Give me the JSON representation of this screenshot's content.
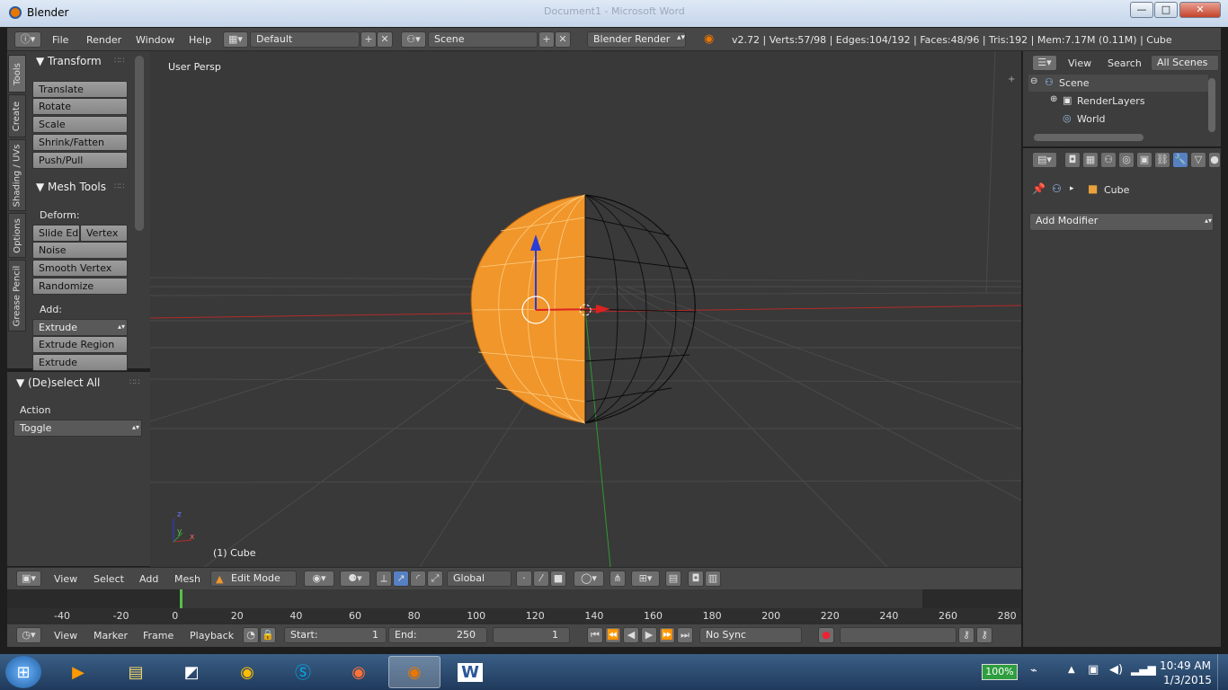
{
  "window": {
    "title": "Blender",
    "ghost_title": "Document1 - Microsoft Word",
    "min": "—",
    "max": "□",
    "close": "✕"
  },
  "info_bar": {
    "menus": [
      "File",
      "Render",
      "Window",
      "Help"
    ],
    "screen_layout": "Default",
    "scene": "Scene",
    "engine": "Blender Render",
    "stats": "v2.72 | Verts:57/98 | Edges:104/192 | Faces:48/96 | Tris:192 | Mem:7.17M (0.11M) | Cube"
  },
  "tool_tabs": [
    "Tools",
    "Create",
    "Shading / UVs",
    "Options",
    "Grease Pencil"
  ],
  "tool_shelf": {
    "transform": {
      "title": "Transform",
      "buttons": [
        "Translate",
        "Rotate",
        "Scale",
        "Shrink/Fatten",
        "Push/Pull"
      ]
    },
    "mesh_tools": {
      "title": "Mesh Tools",
      "deform_label": "Deform:",
      "slide_edge": "Slide Ed",
      "vertex": "Vertex",
      "deform_buttons": [
        "Noise",
        "Smooth Vertex",
        "Randomize"
      ],
      "add_label": "Add:",
      "extrude": "Extrude",
      "add_buttons": [
        "Extrude Region",
        "Extrude Individual"
      ]
    }
  },
  "operator_panel": {
    "title": "(De)select All",
    "action_label": "Action",
    "action_value": "Toggle"
  },
  "viewport": {
    "view_name": "User Persp",
    "object_label": "(1) Cube",
    "axis_x": "x",
    "axis_y": "y",
    "axis_z": "z"
  },
  "header_3d": {
    "menus": [
      "View",
      "Select",
      "Add",
      "Mesh"
    ],
    "mode": "Edit Mode",
    "orientation": "Global"
  },
  "timeline": {
    "ticks": [
      "-40",
      "-20",
      "0",
      "20",
      "40",
      "60",
      "80",
      "100",
      "120",
      "140",
      "160",
      "180",
      "200",
      "220",
      "240",
      "260",
      "280"
    ],
    "menus": [
      "View",
      "Marker",
      "Frame",
      "Playback"
    ],
    "start_label": "Start:",
    "start": "1",
    "end_label": "End:",
    "end": "250",
    "current": "1",
    "sync": "No Sync"
  },
  "outliner": {
    "tabs": [
      "View",
      "Search",
      "All Scenes"
    ],
    "items": [
      "Scene",
      "RenderLayers",
      "World"
    ]
  },
  "properties": {
    "object": "Cube",
    "add_modifier": "Add Modifier"
  },
  "taskbar": {
    "battery": "100%",
    "time": "10:49 AM",
    "date": "1/3/2015"
  },
  "colors": {
    "selected_face": "#f0962b",
    "wire": "#111111",
    "x_axis": "#b52a2a",
    "y_axis": "#2f9a2f",
    "z_axis": "#2a3cd6"
  }
}
